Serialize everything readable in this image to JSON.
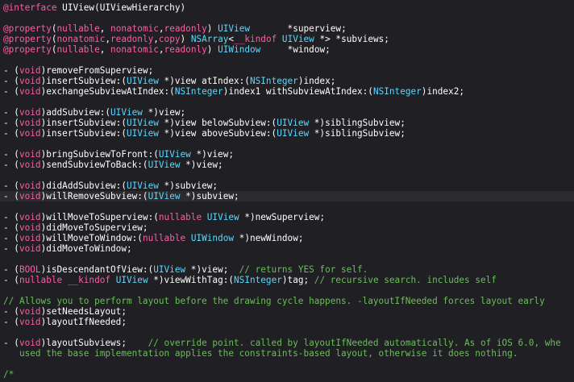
{
  "colors": {
    "background": "#1f1f24",
    "keyword": "#fc5fa3",
    "type": "#5dd8ff",
    "comment": "#6bbf59",
    "plain": "#ffffff",
    "current_line": "#2a2a2f"
  },
  "lines": [
    [
      [
        "k",
        "@interface"
      ],
      [
        "p",
        " UIView(UIViewHierarchy)"
      ]
    ],
    [],
    [
      [
        "k",
        "@property"
      ],
      [
        "p",
        "("
      ],
      [
        "k",
        "nullable"
      ],
      [
        "p",
        ", "
      ],
      [
        "k",
        "nonatomic"
      ],
      [
        "p",
        ","
      ],
      [
        "k",
        "readonly"
      ],
      [
        "p",
        ") "
      ],
      [
        "t",
        "UIView"
      ],
      [
        "p",
        "       *superview;"
      ]
    ],
    [
      [
        "k",
        "@property"
      ],
      [
        "p",
        "("
      ],
      [
        "k",
        "nonatomic"
      ],
      [
        "p",
        ","
      ],
      [
        "k",
        "readonly"
      ],
      [
        "p",
        ","
      ],
      [
        "k",
        "copy"
      ],
      [
        "p",
        ") "
      ],
      [
        "t",
        "NSArray"
      ],
      [
        "p",
        "<"
      ],
      [
        "k",
        "__kindof"
      ],
      [
        "p",
        " "
      ],
      [
        "t",
        "UIView"
      ],
      [
        "p",
        " *> *subviews;"
      ]
    ],
    [
      [
        "k",
        "@property"
      ],
      [
        "p",
        "("
      ],
      [
        "k",
        "nullable"
      ],
      [
        "p",
        ", "
      ],
      [
        "k",
        "nonatomic"
      ],
      [
        "p",
        ","
      ],
      [
        "k",
        "readonly"
      ],
      [
        "p",
        ") "
      ],
      [
        "t",
        "UIWindow"
      ],
      [
        "p",
        "     *window;"
      ]
    ],
    [],
    [
      [
        "p",
        "- ("
      ],
      [
        "k",
        "void"
      ],
      [
        "p",
        ")removeFromSuperview;"
      ]
    ],
    [
      [
        "p",
        "- ("
      ],
      [
        "k",
        "void"
      ],
      [
        "p",
        ")insertSubview:("
      ],
      [
        "t",
        "UIView"
      ],
      [
        "p",
        " *)view atIndex:("
      ],
      [
        "t",
        "NSInteger"
      ],
      [
        "p",
        ")index;"
      ]
    ],
    [
      [
        "p",
        "- ("
      ],
      [
        "k",
        "void"
      ],
      [
        "p",
        ")exchangeSubviewAtIndex:("
      ],
      [
        "t",
        "NSInteger"
      ],
      [
        "p",
        ")index1 withSubviewAtIndex:("
      ],
      [
        "t",
        "NSInteger"
      ],
      [
        "p",
        ")index2;"
      ]
    ],
    [],
    [
      [
        "p",
        "- ("
      ],
      [
        "k",
        "void"
      ],
      [
        "p",
        ")addSubview:("
      ],
      [
        "t",
        "UIView"
      ],
      [
        "p",
        " *)view;"
      ]
    ],
    [
      [
        "p",
        "- ("
      ],
      [
        "k",
        "void"
      ],
      [
        "p",
        ")insertSubview:("
      ],
      [
        "t",
        "UIView"
      ],
      [
        "p",
        " *)view belowSubview:("
      ],
      [
        "t",
        "UIView"
      ],
      [
        "p",
        " *)siblingSubview;"
      ]
    ],
    [
      [
        "p",
        "- ("
      ],
      [
        "k",
        "void"
      ],
      [
        "p",
        ")insertSubview:("
      ],
      [
        "t",
        "UIView"
      ],
      [
        "p",
        " *)view aboveSubview:("
      ],
      [
        "t",
        "UIView"
      ],
      [
        "p",
        " *)siblingSubview;"
      ]
    ],
    [],
    [
      [
        "p",
        "- ("
      ],
      [
        "k",
        "void"
      ],
      [
        "p",
        ")bringSubviewToFront:("
      ],
      [
        "t",
        "UIView"
      ],
      [
        "p",
        " *)view;"
      ]
    ],
    [
      [
        "p",
        "- ("
      ],
      [
        "k",
        "void"
      ],
      [
        "p",
        ")sendSubviewToBack:("
      ],
      [
        "t",
        "UIView"
      ],
      [
        "p",
        " *)view;"
      ]
    ],
    [],
    [
      [
        "p",
        "- ("
      ],
      [
        "k",
        "void"
      ],
      [
        "p",
        ")didAddSubview:("
      ],
      [
        "t",
        "UIView"
      ],
      [
        "p",
        " *)subview;"
      ]
    ],
    [
      [
        "p",
        "- ("
      ],
      [
        "k",
        "void"
      ],
      [
        "p",
        ")willRemoveSubview:("
      ],
      [
        "t",
        "UIView"
      ],
      [
        "p",
        " *)subview;"
      ]
    ],
    [],
    [
      [
        "p",
        "- ("
      ],
      [
        "k",
        "void"
      ],
      [
        "p",
        ")willMoveToSuperview:("
      ],
      [
        "k",
        "nullable"
      ],
      [
        "p",
        " "
      ],
      [
        "t",
        "UIView"
      ],
      [
        "p",
        " *)newSuperview;"
      ]
    ],
    [
      [
        "p",
        "- ("
      ],
      [
        "k",
        "void"
      ],
      [
        "p",
        ")didMoveToSuperview;"
      ]
    ],
    [
      [
        "p",
        "- ("
      ],
      [
        "k",
        "void"
      ],
      [
        "p",
        ")willMoveToWindow:("
      ],
      [
        "k",
        "nullable"
      ],
      [
        "p",
        " "
      ],
      [
        "t",
        "UIWindow"
      ],
      [
        "p",
        " *)newWindow;"
      ]
    ],
    [
      [
        "p",
        "- ("
      ],
      [
        "k",
        "void"
      ],
      [
        "p",
        ")didMoveToWindow;"
      ]
    ],
    [],
    [
      [
        "p",
        "- ("
      ],
      [
        "k",
        "BOOL"
      ],
      [
        "p",
        ")isDescendantOfView:("
      ],
      [
        "t",
        "UIView"
      ],
      [
        "p",
        " *)view;  "
      ],
      [
        "c",
        "// returns YES for self."
      ]
    ],
    [
      [
        "p",
        "- ("
      ],
      [
        "k",
        "nullable"
      ],
      [
        "p",
        " "
      ],
      [
        "k",
        "__kindof"
      ],
      [
        "p",
        " "
      ],
      [
        "t",
        "UIView"
      ],
      [
        "p",
        " *)viewWithTag:("
      ],
      [
        "t",
        "NSInteger"
      ],
      [
        "p",
        ")tag; "
      ],
      [
        "c",
        "// recursive search. includes self"
      ]
    ],
    [],
    [
      [
        "c",
        "// Allows you to perform layout before the drawing cycle happens. -layoutIfNeeded forces layout early"
      ]
    ],
    [
      [
        "p",
        "- ("
      ],
      [
        "k",
        "void"
      ],
      [
        "p",
        ")setNeedsLayout;"
      ]
    ],
    [
      [
        "p",
        "- ("
      ],
      [
        "k",
        "void"
      ],
      [
        "p",
        ")layoutIfNeeded;"
      ]
    ],
    [],
    [
      [
        "p",
        "- ("
      ],
      [
        "k",
        "void"
      ],
      [
        "p",
        ")layoutSubviews;    "
      ],
      [
        "c",
        "// override point. called by layoutIfNeeded automatically. As of iOS 6.0, whe"
      ]
    ],
    [
      [
        "c",
        "   used the base implementation applies the constraints-based layout, otherwise it does nothing."
      ]
    ],
    [],
    [
      [
        "c",
        "/*"
      ]
    ]
  ],
  "highlighted_line_index": 18
}
